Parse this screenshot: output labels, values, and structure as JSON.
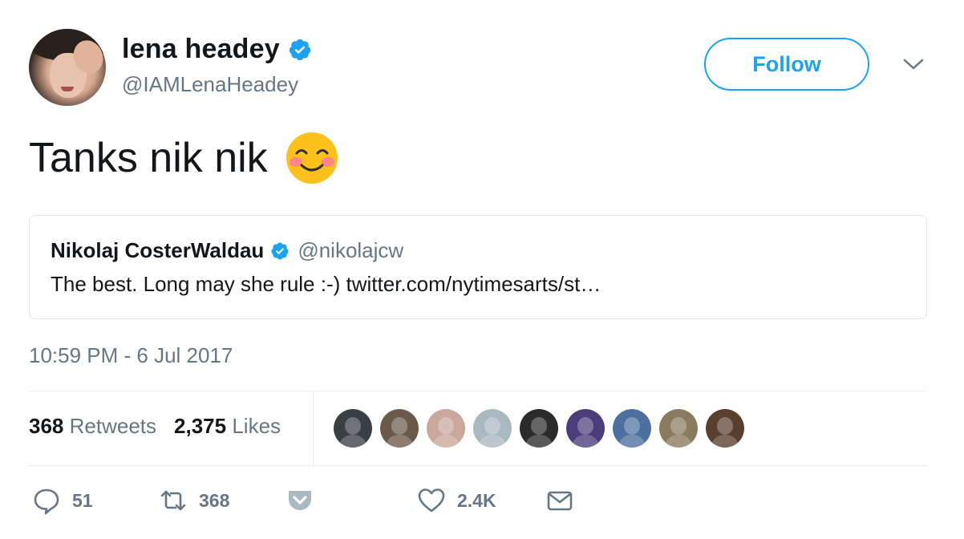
{
  "author": {
    "display_name": "lena headey",
    "handle": "@IAMLenaHeadey",
    "verified_icon": "verified-badge-icon"
  },
  "follow_button": {
    "label": "Follow"
  },
  "tweet": {
    "text": "Tanks nik nik",
    "emoji": "smiling-face-with-blush-emoji"
  },
  "quoted_tweet": {
    "name": "Nikolaj CosterWaldau",
    "handle": "@nikolajcw",
    "text": "The best. Long may she rule :-) twitter.com/nytimesarts/st…"
  },
  "timestamp": "10:59 PM - 6 Jul 2017",
  "stats": {
    "retweets_count": "368",
    "retweets_label": "Retweets",
    "likes_count": "2,375",
    "likes_label": "Likes"
  },
  "likers": [
    {
      "name": "liker-avatar-1",
      "color": "#3a3f44"
    },
    {
      "name": "liker-avatar-2",
      "color": "#6b5a4a"
    },
    {
      "name": "liker-avatar-3",
      "color": "#c9a79a"
    },
    {
      "name": "liker-avatar-4",
      "color": "#aab8c2"
    },
    {
      "name": "liker-avatar-5",
      "color": "#2b2b2b"
    },
    {
      "name": "liker-avatar-6",
      "color": "#4a3d7a"
    },
    {
      "name": "liker-avatar-7",
      "color": "#4b6f9e"
    },
    {
      "name": "liker-avatar-8",
      "color": "#8a7a5f"
    },
    {
      "name": "liker-avatar-9",
      "color": "#5a3e2e"
    }
  ],
  "actions": {
    "reply_count": "51",
    "retweet_count": "368",
    "like_count": "2.4K"
  },
  "colors": {
    "accent": "#1da1f2",
    "text": "#14171a",
    "secondary": "#657786"
  }
}
